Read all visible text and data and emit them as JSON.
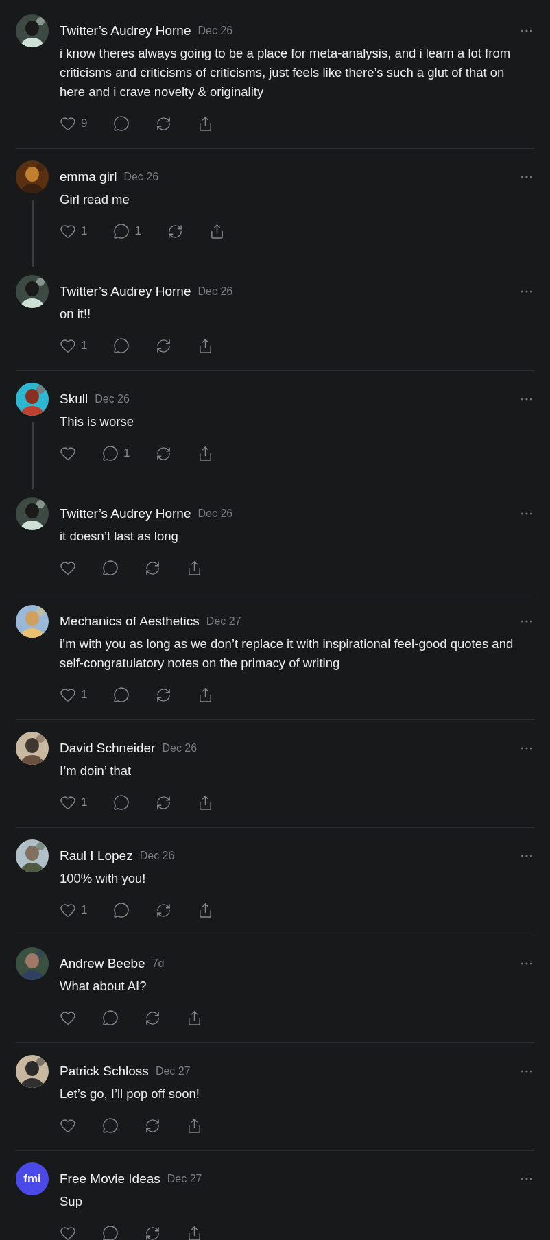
{
  "groups": [
    {
      "comments": [
        {
          "author": "Twitter’s Audrey Horne",
          "date": "Dec 26",
          "text": "i know theres always going to be a place for meta-analysis, and i learn a lot from criticisms and criticisms of criticisms, just feels like there’s such a glut of that on here and i crave novelty & originality",
          "likes": "9"
        }
      ]
    },
    {
      "comments": [
        {
          "author": "emma girl",
          "date": "Dec 26",
          "text": "Girl read me",
          "likes": "1",
          "replies": "1"
        },
        {
          "author": "Twitter’s Audrey Horne",
          "date": "Dec 26",
          "text": "on it!!",
          "likes": "1"
        }
      ]
    },
    {
      "comments": [
        {
          "author": "Skull",
          "date": "Dec 26",
          "text": "This is worse",
          "replies": "1"
        },
        {
          "author": "Twitter’s Audrey Horne",
          "date": "Dec 26",
          "text": "it doesn’t last as long"
        }
      ]
    },
    {
      "comments": [
        {
          "author": "Mechanics of Aesthetics",
          "date": "Dec 27",
          "text": "i’m with you as long as we don’t replace it with inspirational feel-good quotes and self-congratulatory notes on the primacy of writing",
          "likes": "1"
        }
      ]
    },
    {
      "comments": [
        {
          "author": "David Schneider",
          "date": "Dec 26",
          "text": "I’m doin’ that",
          "likes": "1"
        }
      ]
    },
    {
      "comments": [
        {
          "author": "Raul I Lopez",
          "date": "Dec 26",
          "text": "100% with you!",
          "likes": "1"
        }
      ]
    },
    {
      "comments": [
        {
          "author": "Andrew Beebe",
          "date": "7d",
          "text": "What about AI?"
        }
      ]
    },
    {
      "comments": [
        {
          "author": "Patrick Schloss",
          "date": "Dec 27",
          "text": "Let’s go, I’ll pop off soon!"
        }
      ]
    },
    {
      "comments": [
        {
          "author": "Free Movie Ideas",
          "date": "Dec 27",
          "text": "Sup",
          "avatar": {
            "kind": "logo",
            "text": "fmi"
          }
        }
      ]
    }
  ]
}
